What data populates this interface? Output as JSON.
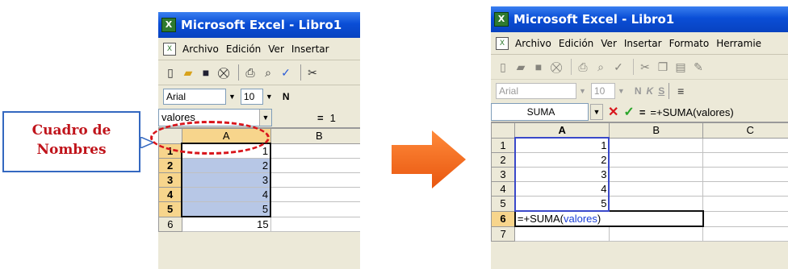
{
  "callout": {
    "line1": "Cuadro de",
    "line2": "Nombres"
  },
  "left_window": {
    "title": "Microsoft Excel - Libro1",
    "menu": [
      "Archivo",
      "Edición",
      "Ver",
      "Insertar"
    ],
    "font_name": "Arial",
    "font_size": "10",
    "bold": "N",
    "name_box": "valores",
    "equals": "=",
    "formula_preview": "1",
    "columns": [
      "A",
      "B"
    ],
    "rows": [
      {
        "n": "1",
        "a": "1"
      },
      {
        "n": "2",
        "a": "2"
      },
      {
        "n": "3",
        "a": "3"
      },
      {
        "n": "4",
        "a": "4"
      },
      {
        "n": "5",
        "a": "5"
      },
      {
        "n": "6",
        "a": "15"
      }
    ],
    "selected_range": "A1:A5",
    "selection_color": "#b7c7e6"
  },
  "right_window": {
    "title": "Microsoft Excel - Libro1",
    "menu": [
      "Archivo",
      "Edición",
      "Ver",
      "Insertar",
      "Formato",
      "Herramie"
    ],
    "font_name": "Arial",
    "font_size": "10",
    "format_buttons": [
      "N",
      "K",
      "S"
    ],
    "name_box": "SUMA",
    "cancel": "✕",
    "enter": "✓",
    "equals": "=",
    "formula": "=+SUMA(valores)",
    "columns": [
      "A",
      "B",
      "C"
    ],
    "rows": [
      {
        "n": "1",
        "a": "1"
      },
      {
        "n": "2",
        "a": "2"
      },
      {
        "n": "3",
        "a": "3"
      },
      {
        "n": "4",
        "a": "4"
      },
      {
        "n": "5",
        "a": "5"
      },
      {
        "n": "6",
        "a": ""
      },
      {
        "n": "7",
        "a": ""
      }
    ],
    "cell_edit": {
      "prefix": "=+SUMA(",
      "name": "valores",
      "suffix": ")"
    }
  },
  "colors": {
    "title_bar": "#0a4ed6",
    "callout_text": "#c0141b",
    "arrow": "#f26a1b",
    "highlight_ellipse": "#d8151b"
  },
  "icons": [
    "excel-icon",
    "new-icon",
    "open-icon",
    "save-icon",
    "permission-icon",
    "print-icon",
    "print-preview-icon",
    "spelling-icon",
    "cut-icon",
    "copy-icon",
    "paste-icon",
    "format-painter-icon"
  ]
}
